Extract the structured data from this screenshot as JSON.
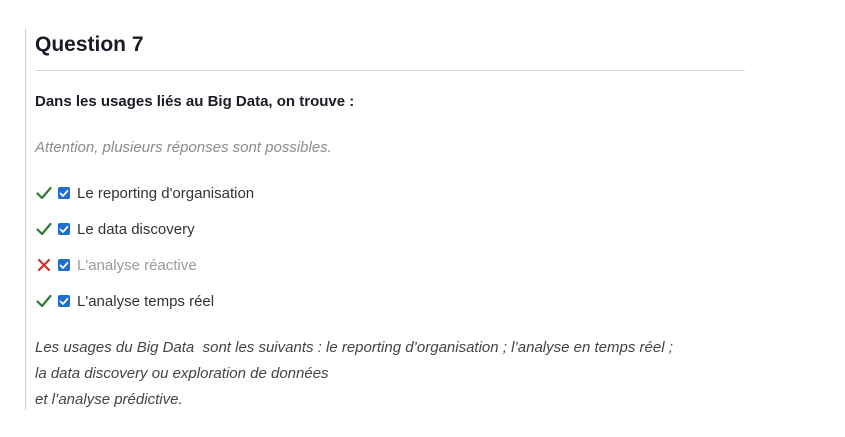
{
  "question": {
    "title": "Question 7",
    "prompt": "Dans les usages liés au Big Data, on trouve :",
    "instructions": "Attention, plusieurs réponses sont possibles.",
    "answers": [
      {
        "label": "Le reporting d'organisation",
        "checked": true,
        "result": "correct",
        "mark_icon": "checkmark-icon"
      },
      {
        "label": "Le data discovery",
        "checked": true,
        "result": "correct",
        "mark_icon": "checkmark-icon"
      },
      {
        "label": "L'analyse réactive",
        "checked": true,
        "result": "incorrect",
        "mark_icon": "cross-icon"
      },
      {
        "label": "L'analyse temps réel",
        "checked": true,
        "result": "correct",
        "mark_icon": "checkmark-icon"
      }
    ],
    "feedback": [
      "Les usages du Big Data  sont les suivants : le reporting d’organisation ; l’analyse en temps réel ;",
      "la data discovery ou exploration de données",
      "et l’analyse prédictive."
    ]
  },
  "colors": {
    "correct": "#2e7d32",
    "incorrect": "#d32f2f",
    "checkbox": "#1f6fd1"
  }
}
